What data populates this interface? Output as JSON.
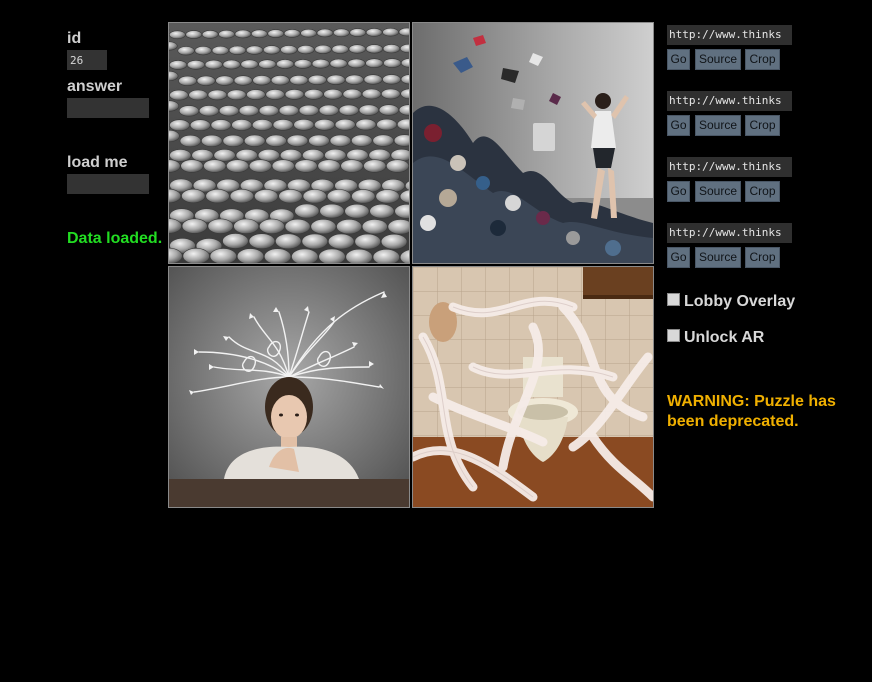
{
  "left": {
    "id_label": "id",
    "id_value": "26",
    "answer_label": "answer",
    "answer_value": "",
    "load_label": "load me",
    "load_value": "",
    "status_text": "Data loaded.",
    "status_color": "#22dd22"
  },
  "tiles": [
    {
      "subject": "coins-pile"
    },
    {
      "subject": "laundry-pile"
    },
    {
      "subject": "woman-thinking-arrows"
    },
    {
      "subject": "toilet-paper-bathroom"
    }
  ],
  "urls": [
    {
      "value": "http://www.thinks",
      "go": "Go",
      "source": "Source",
      "crop": "Crop"
    },
    {
      "value": "http://www.thinks",
      "go": "Go",
      "source": "Source",
      "crop": "Crop"
    },
    {
      "value": "http://www.thinks",
      "go": "Go",
      "source": "Source",
      "crop": "Crop"
    },
    {
      "value": "http://www.thinks",
      "go": "Go",
      "source": "Source",
      "crop": "Crop"
    }
  ],
  "checkboxes": [
    {
      "label": "Lobby Overlay",
      "checked": false
    },
    {
      "label": "Unlock AR",
      "checked": false
    }
  ],
  "warning": {
    "text": "WARNING: Puzzle has been deprecated.",
    "color": "#f0b000"
  },
  "colors": {
    "background": "#000000",
    "button": "#607080",
    "field": "#333333"
  }
}
